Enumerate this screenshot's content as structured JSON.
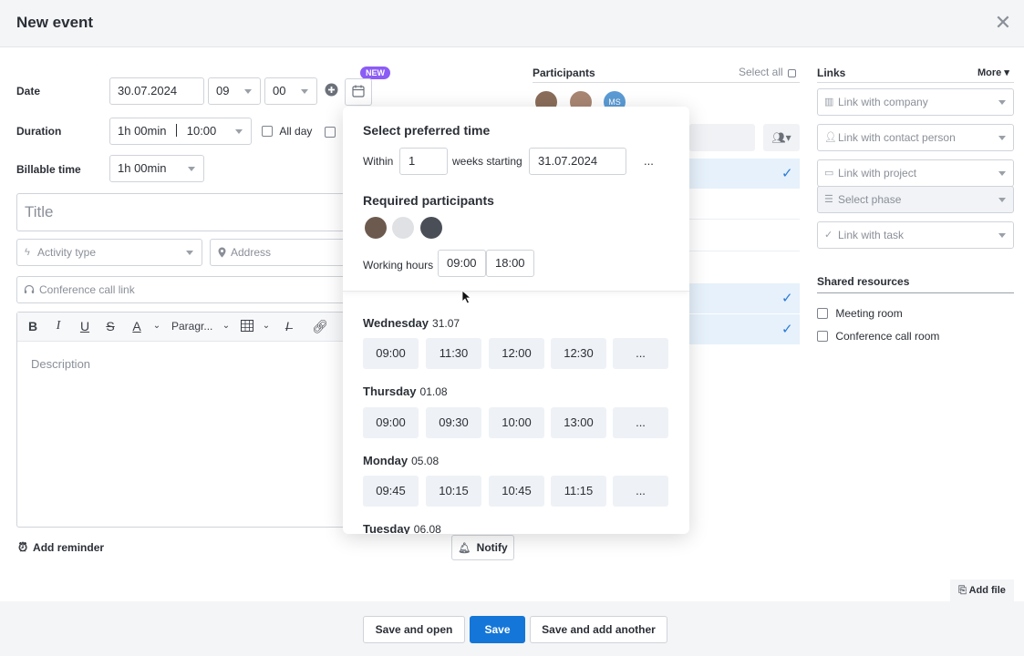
{
  "header": {
    "title": "New event",
    "close_icon": "close-icon"
  },
  "form": {
    "date_label": "Date",
    "date_value": "30.07.2024",
    "hour_value": "09",
    "minute_value": "00",
    "new_badge": "NEW",
    "duration_label": "Duration",
    "duration_value": "1h 00min",
    "duration_end": "10:00",
    "all_day_label": "All day",
    "billable_label": "Billable time",
    "billable_value": "1h 00min",
    "title_placeholder": "Title",
    "activity_placeholder": "Activity type",
    "address_placeholder": "Address",
    "conference_placeholder": "Conference call link",
    "paragraph_label": "Paragr...",
    "description_placeholder": "Description",
    "add_reminder": "Add reminder",
    "notify": "Notify"
  },
  "participants": {
    "title": "Participants",
    "select_all": "Select all",
    "initials": "MS"
  },
  "popup": {
    "title": "Select preferred time",
    "within_label": "Within",
    "within_value": "1",
    "weeks_label": "weeks starting",
    "start_date": "31.07.2024",
    "more": "...",
    "required_title": "Required participants",
    "working_hours_label": "Working hours",
    "work_start": "09:00",
    "work_end": "18:00",
    "days": [
      {
        "name": "Wednesday",
        "date": "31.07",
        "slots": [
          "09:00",
          "11:30",
          "12:00",
          "12:30",
          "..."
        ]
      },
      {
        "name": "Thursday",
        "date": "01.08",
        "slots": [
          "09:00",
          "09:30",
          "10:00",
          "13:00",
          "..."
        ]
      },
      {
        "name": "Monday",
        "date": "05.08",
        "slots": [
          "09:45",
          "10:15",
          "10:45",
          "11:15",
          "..."
        ]
      },
      {
        "name": "Tuesday",
        "date": "06.08",
        "slots": []
      }
    ]
  },
  "links": {
    "title": "Links",
    "more": "More",
    "company": "Link with company",
    "contact": "Link with contact person",
    "project": "Link with project",
    "phase": "Select phase",
    "task": "Link with task"
  },
  "resources": {
    "title": "Shared resources",
    "meeting_room": "Meeting room",
    "conference_room": "Conference call room"
  },
  "footer": {
    "add_file": "Add file",
    "save_open": "Save and open",
    "save": "Save",
    "save_add": "Save and add another"
  },
  "colors": {
    "primary": "#1476d8",
    "badge": "#8b5cf6",
    "selected_bg": "#e6f1fb"
  }
}
